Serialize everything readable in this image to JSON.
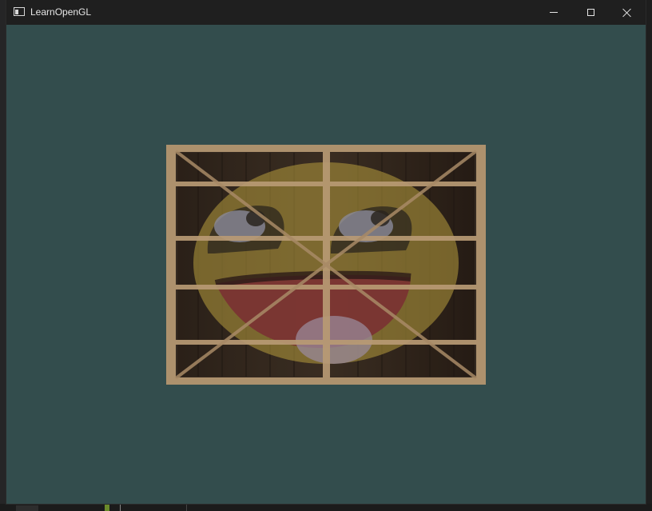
{
  "window": {
    "title": "LearnOpenGL",
    "clear_color": "#334d4d"
  },
  "titlebar": {
    "icon": "app-window-icon",
    "minimize_icon": "minimize-icon",
    "maximize_icon": "maximize-icon",
    "close_icon": "close-icon"
  },
  "scene": {
    "texture_1": "wooden-container",
    "texture_2": "awesome-face",
    "mix_amount": 0.2
  }
}
